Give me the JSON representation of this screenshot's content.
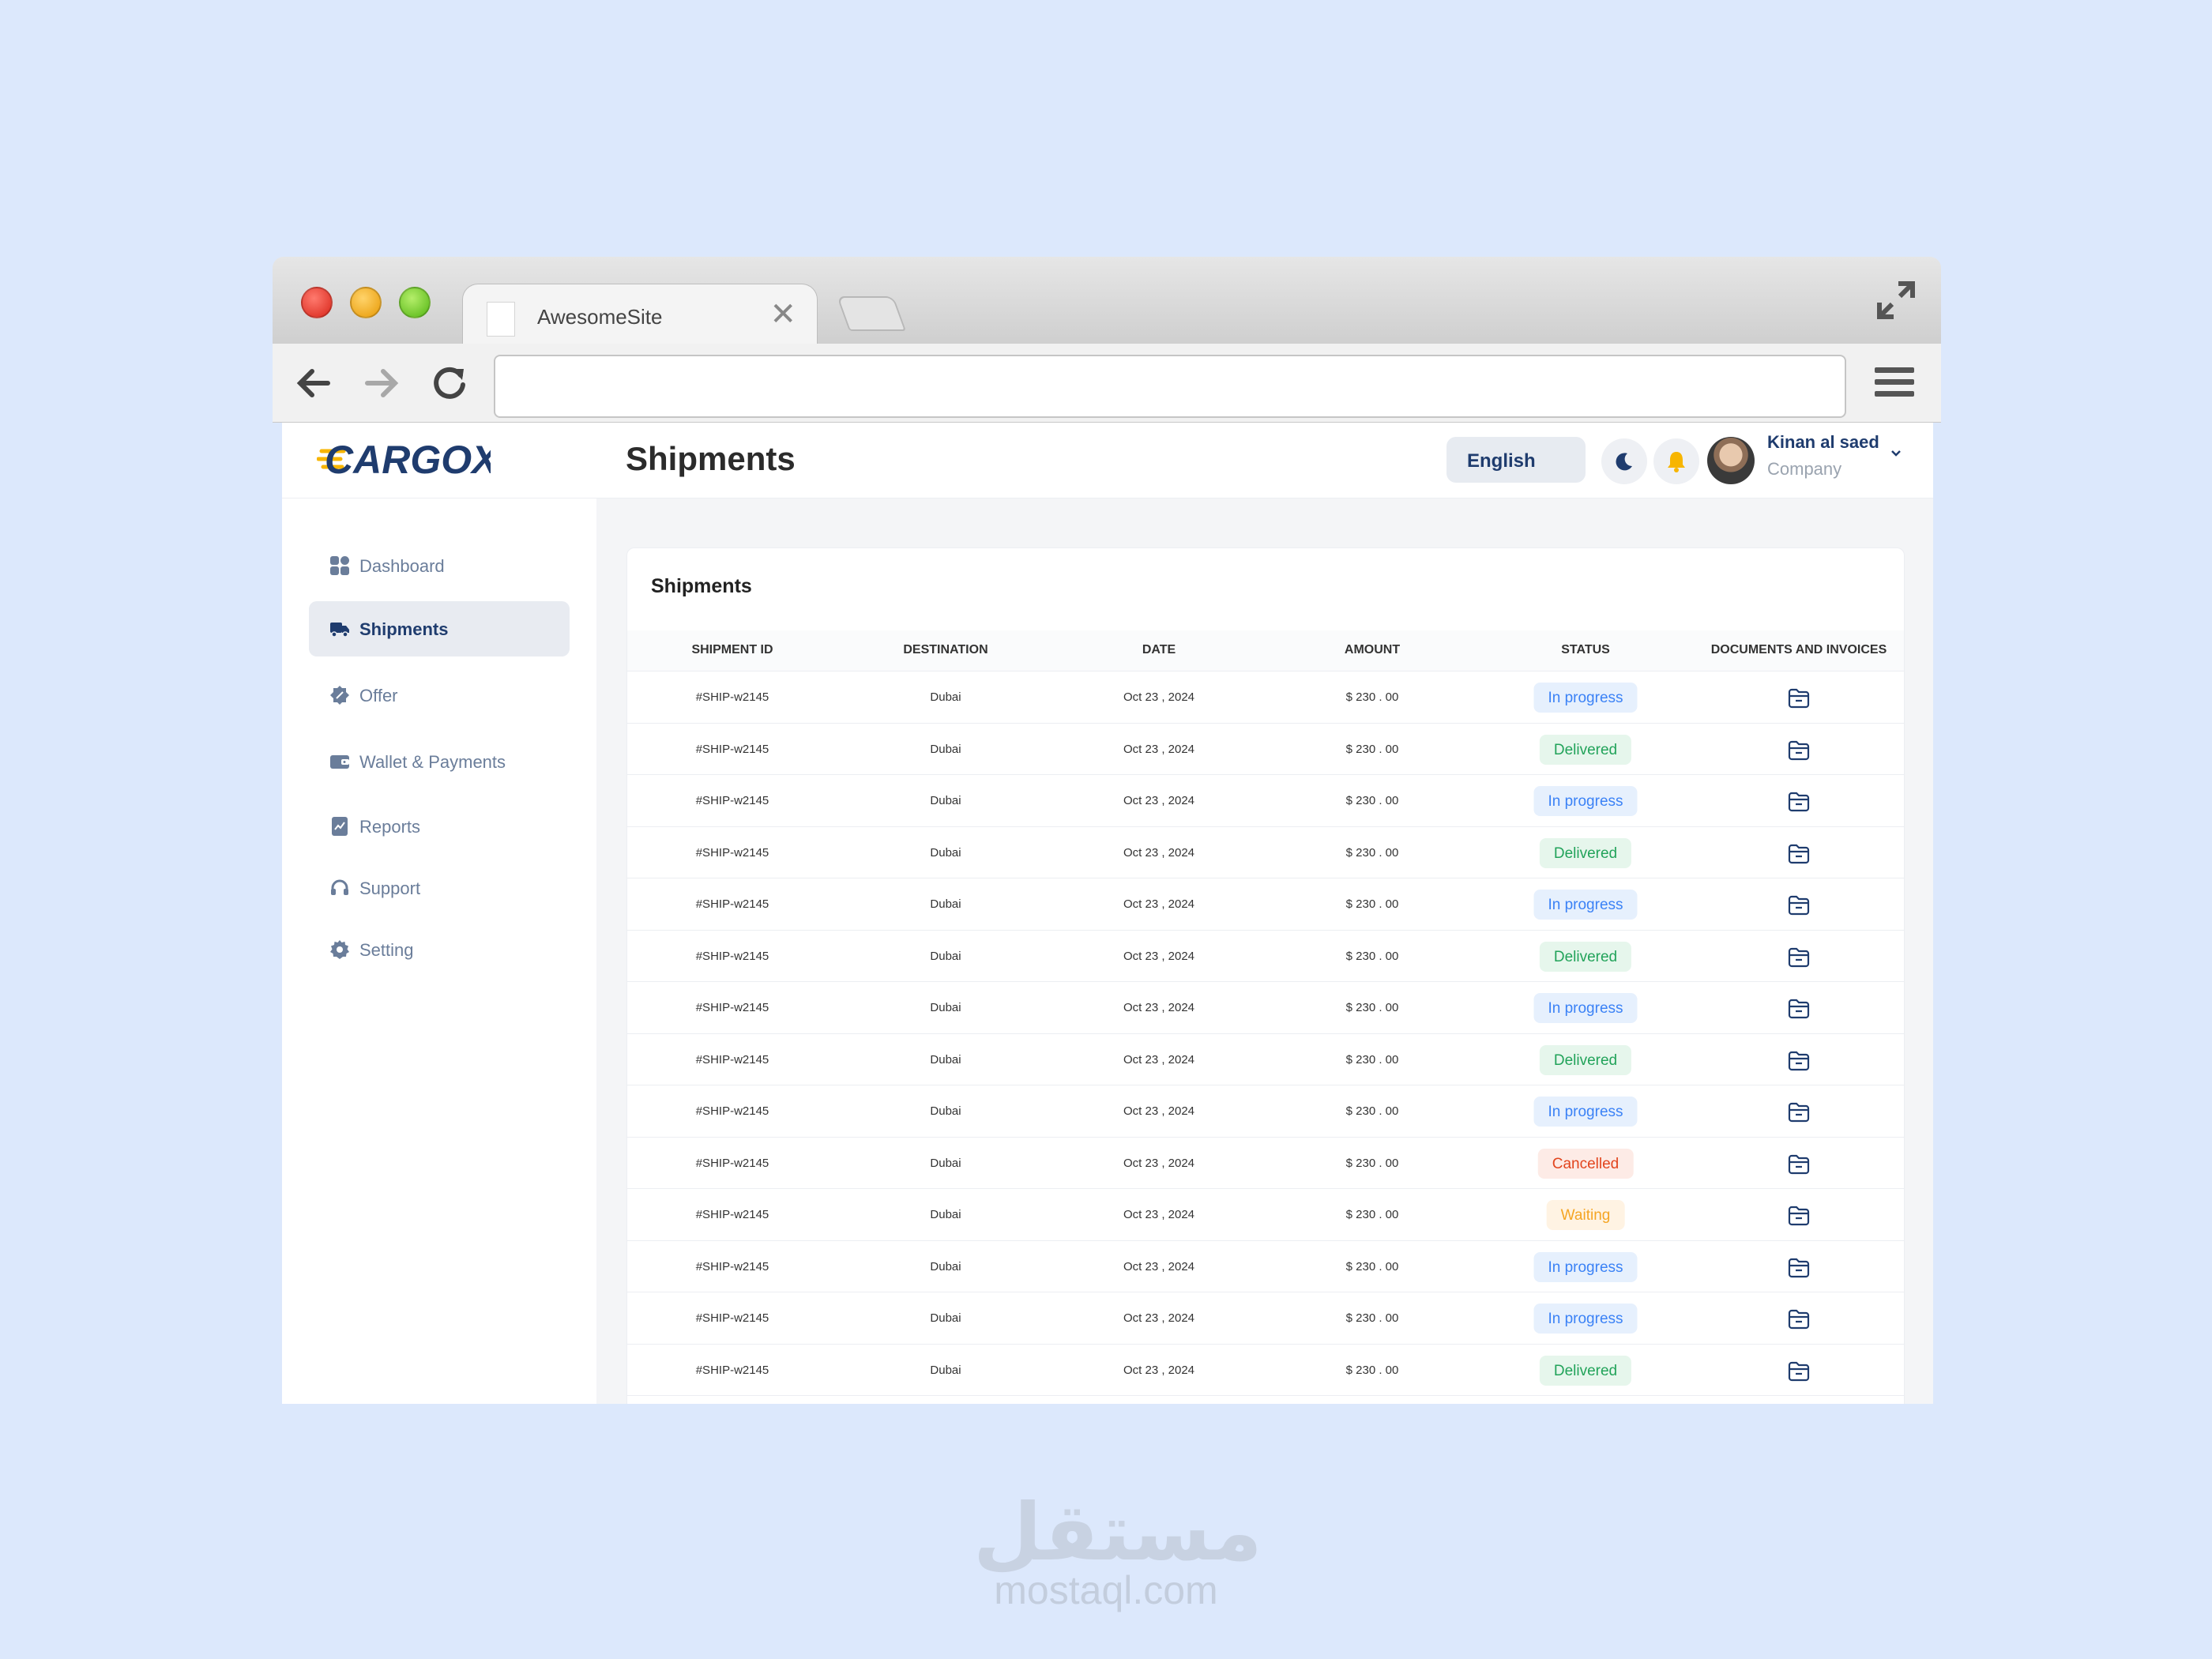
{
  "browser": {
    "tab_title": "AwesomeSite",
    "tab_close": "✕",
    "address": ""
  },
  "app": {
    "logo_text": "CARGOX",
    "page_title": "Shipments",
    "language": "English",
    "user": {
      "name": "Kinan al saed",
      "role": "Company"
    },
    "colors": {
      "primary": "#1f3c6e",
      "accent": "#f7b500",
      "active_bg": "#e8ebf1"
    }
  },
  "sidebar": {
    "items": [
      {
        "label": "Dashboard",
        "icon": "grid-icon"
      },
      {
        "label": "Shipments",
        "icon": "truck-icon",
        "active": true
      },
      {
        "label": "Offer",
        "icon": "badge-icon"
      },
      {
        "label": "Wallet & Payments",
        "icon": "wallet-icon"
      },
      {
        "label": "Reports",
        "icon": "report-icon"
      },
      {
        "label": "Support",
        "icon": "headset-icon"
      },
      {
        "label": "Setting",
        "icon": "gear-icon"
      }
    ]
  },
  "table": {
    "title": "Shipments",
    "columns": [
      "SHIPMENT ID",
      "DESTINATION",
      "DATE",
      "AMOUNT",
      "STATUS",
      "DOCUMENTS AND INVOICES"
    ],
    "rows": [
      {
        "id": "#SHIP-w2145",
        "destination": "Dubai",
        "date": "Oct 23 , 2024",
        "amount": "$ 230 . 00",
        "status": "In progress"
      },
      {
        "id": "#SHIP-w2145",
        "destination": "Dubai",
        "date": "Oct 23 , 2024",
        "amount": "$ 230 . 00",
        "status": "Delivered"
      },
      {
        "id": "#SHIP-w2145",
        "destination": "Dubai",
        "date": "Oct 23 , 2024",
        "amount": "$ 230 . 00",
        "status": "In progress"
      },
      {
        "id": "#SHIP-w2145",
        "destination": "Dubai",
        "date": "Oct 23 , 2024",
        "amount": "$ 230 . 00",
        "status": "Delivered"
      },
      {
        "id": "#SHIP-w2145",
        "destination": "Dubai",
        "date": "Oct 23 , 2024",
        "amount": "$ 230 . 00",
        "status": "In progress"
      },
      {
        "id": "#SHIP-w2145",
        "destination": "Dubai",
        "date": "Oct 23 , 2024",
        "amount": "$ 230 . 00",
        "status": "Delivered"
      },
      {
        "id": "#SHIP-w2145",
        "destination": "Dubai",
        "date": "Oct 23 , 2024",
        "amount": "$ 230 . 00",
        "status": "In progress"
      },
      {
        "id": "#SHIP-w2145",
        "destination": "Dubai",
        "date": "Oct 23 , 2024",
        "amount": "$ 230 . 00",
        "status": "Delivered"
      },
      {
        "id": "#SHIP-w2145",
        "destination": "Dubai",
        "date": "Oct 23 , 2024",
        "amount": "$ 230 . 00",
        "status": "In progress"
      },
      {
        "id": "#SHIP-w2145",
        "destination": "Dubai",
        "date": "Oct 23 , 2024",
        "amount": "$ 230 . 00",
        "status": "Cancelled"
      },
      {
        "id": "#SHIP-w2145",
        "destination": "Dubai",
        "date": "Oct 23 , 2024",
        "amount": "$ 230 . 00",
        "status": "Waiting"
      },
      {
        "id": "#SHIP-w2145",
        "destination": "Dubai",
        "date": "Oct 23 , 2024",
        "amount": "$ 230 . 00",
        "status": "In progress"
      },
      {
        "id": "#SHIP-w2145",
        "destination": "Dubai",
        "date": "Oct 23 , 2024",
        "amount": "$ 230 . 00",
        "status": "In progress"
      },
      {
        "id": "#SHIP-w2145",
        "destination": "Dubai",
        "date": "Oct 23 , 2024",
        "amount": "$ 230 . 00",
        "status": "Delivered"
      }
    ]
  },
  "status_styles": {
    "In progress": {
      "bg": "#e6f0fd",
      "fg": "#3b82f6"
    },
    "Delivered": {
      "bg": "#e6f6ec",
      "fg": "#22a35a"
    },
    "Cancelled": {
      "bg": "#fdebe6",
      "fg": "#e2451e"
    },
    "Waiting": {
      "bg": "#fff3e3",
      "fg": "#f5a524"
    }
  },
  "watermark": {
    "arabic": "مستقل",
    "domain": "mostaql.com"
  }
}
